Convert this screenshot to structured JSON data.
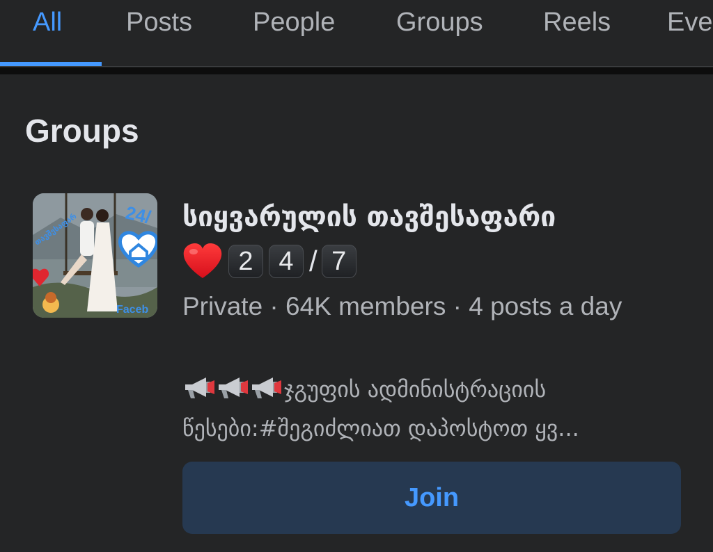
{
  "tabs": [
    {
      "label": "All",
      "active": true
    },
    {
      "label": "Posts",
      "active": false
    },
    {
      "label": "People",
      "active": false
    },
    {
      "label": "Groups",
      "active": false
    },
    {
      "label": "Reels",
      "active": false
    },
    {
      "label": "Eve",
      "active": false
    }
  ],
  "section": {
    "title": "Groups"
  },
  "group": {
    "name": "სიყვარულის თავშესაფარი",
    "emoji": [
      "heart-icon"
    ],
    "keycaps": [
      "2",
      "4",
      "7"
    ],
    "slash": "/",
    "meta": "Private · 64K members · 4 posts a day",
    "description_icons": [
      "megaphone-icon",
      "megaphone-icon",
      "megaphone-icon"
    ],
    "description": "ჯგუფის ადმინისტრაციის წესები:#შეგიძლიათ დაპოსტოთ ყვ..."
  },
  "join_button": {
    "label": "Join"
  },
  "colors": {
    "background": "#242526",
    "accent": "#4599ff",
    "primary_text": "#e4e6eb",
    "secondary_text": "#b0b3b8",
    "button_bg": "#263951"
  }
}
